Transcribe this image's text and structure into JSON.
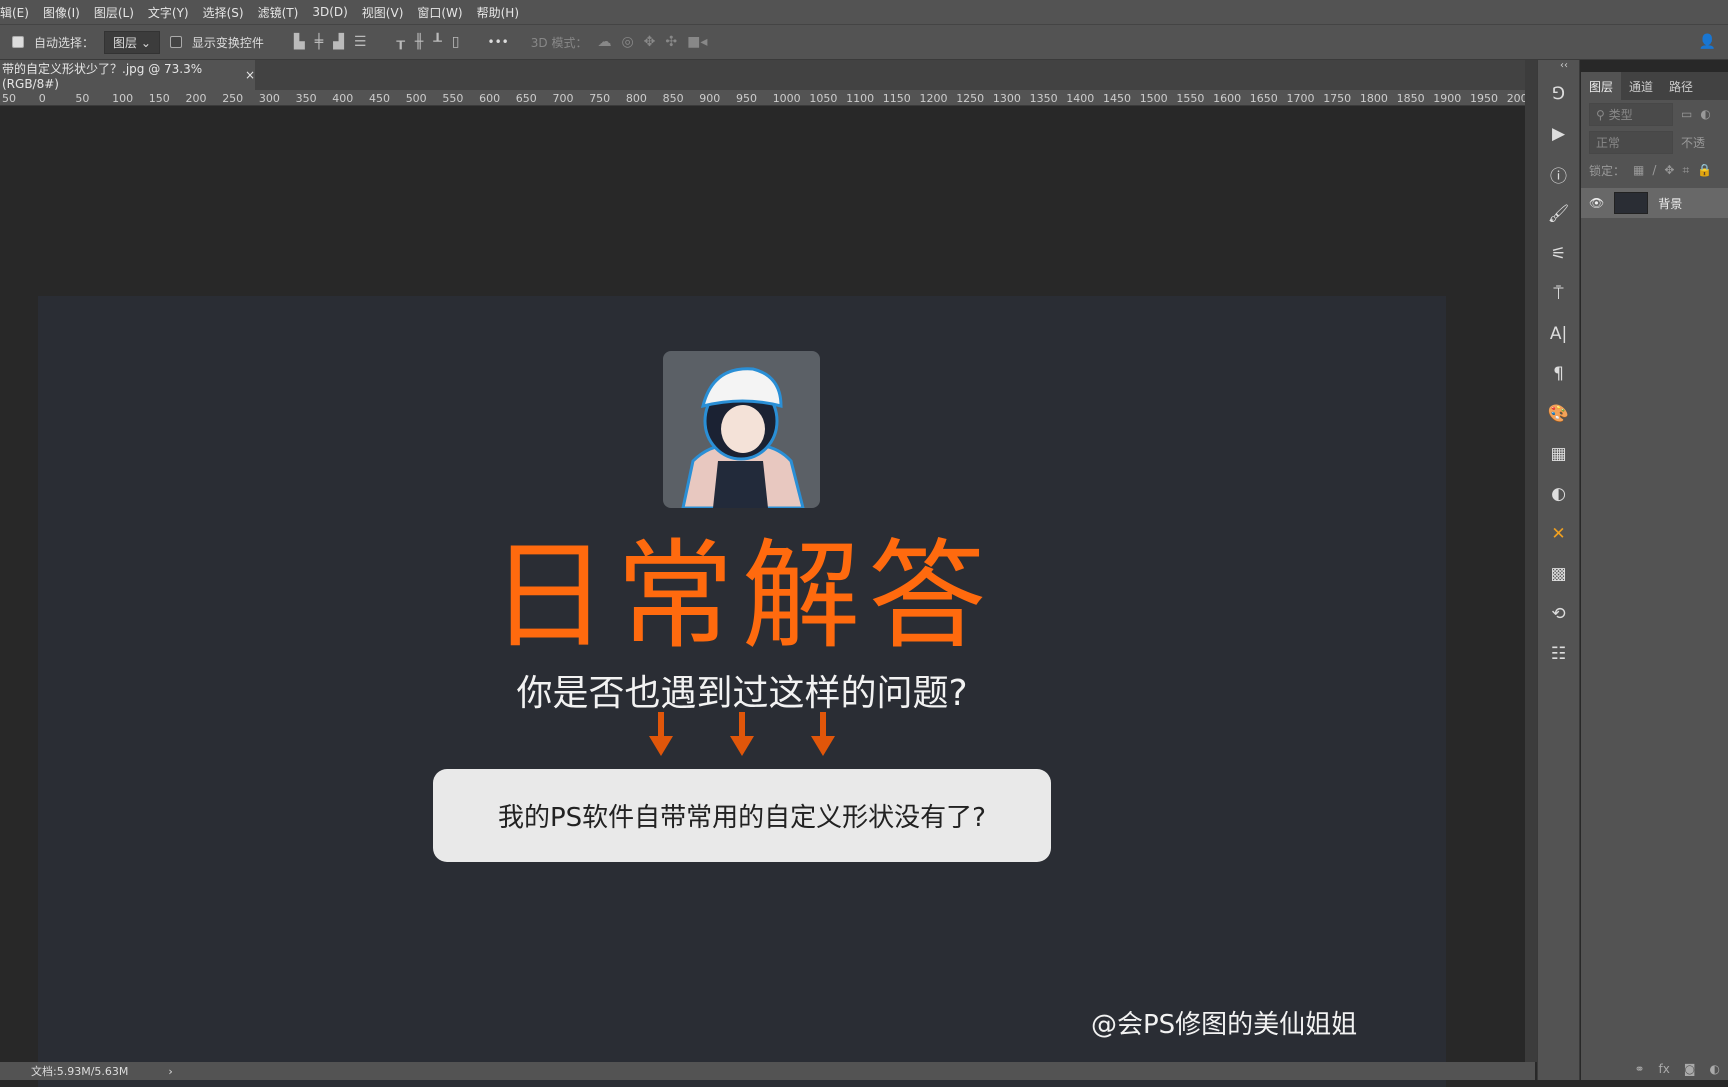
{
  "menu": [
    "辑(E)",
    "图像(I)",
    "图层(L)",
    "文字(Y)",
    "选择(S)",
    "滤镜(T)",
    "3D(D)",
    "视图(V)",
    "窗口(W)",
    "帮助(H)"
  ],
  "options": {
    "auto_select": "自动选择：",
    "auto_select_target": "图层",
    "show_transform": "显示变换控件",
    "more": "•••",
    "mode_3d": "3D 模式："
  },
  "doc_tab": {
    "title": "带的自定义形状少了？.jpg @ 73.3%(RGB/8#)",
    "close": "×"
  },
  "ruler": [
    "50",
    "0",
    "50",
    "100",
    "150",
    "200",
    "250",
    "300",
    "350",
    "400",
    "450",
    "500",
    "550",
    "600",
    "650",
    "700",
    "750",
    "800",
    "850",
    "900",
    "950",
    "1000",
    "1050",
    "1100",
    "1150",
    "1200",
    "1250",
    "1300",
    "1350",
    "1400",
    "1450",
    "1500",
    "1550",
    "1600",
    "1650",
    "1700",
    "1750",
    "1800",
    "1850",
    "1900",
    "1950",
    "200"
  ],
  "canvas": {
    "title": "日常解答",
    "subtitle": "你是否也遇到过这样的问题?",
    "question": "我的PS软件自带常用的自定义形状没有了?",
    "signature": "@会PS修图的美仙姐姐",
    "accent": "#ff6a0e"
  },
  "status": {
    "doc_size": "文档:5.93M/5.63M",
    "arrow": "›"
  },
  "panel": {
    "collapse": "‹‹",
    "tabs": [
      "图层",
      "通道",
      "路径"
    ],
    "filter_placeholder": "类型",
    "blend_mode": "正常",
    "opacity_label": "不透",
    "lock_label": "锁定：",
    "layer_name": "背景"
  }
}
